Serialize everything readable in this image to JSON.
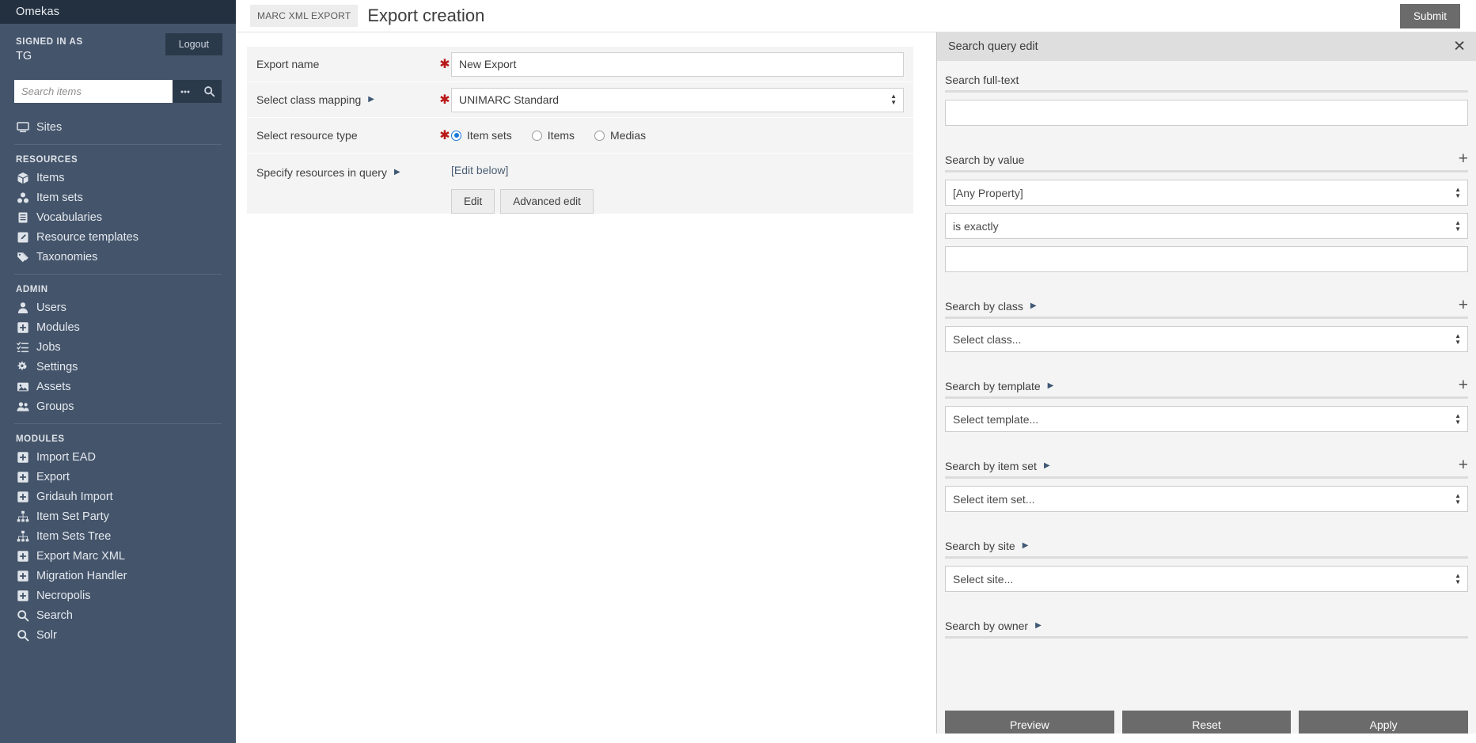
{
  "sidebar": {
    "brand": "Omekas",
    "signed_in_label": "SIGNED IN AS",
    "user": "TG",
    "logout_label": "Logout",
    "search_placeholder": "Search items",
    "search_value": "",
    "advanced_icon": "ellipsis-icon",
    "search_icon": "search-icon",
    "top_items": [
      {
        "label": "Sites",
        "icon": "monitor-icon"
      }
    ],
    "groups": [
      {
        "heading": "RESOURCES",
        "items": [
          {
            "label": "Items",
            "icon": "cube-icon"
          },
          {
            "label": "Item sets",
            "icon": "item-sets-icon"
          },
          {
            "label": "Vocabularies",
            "icon": "book-icon"
          },
          {
            "label": "Resource templates",
            "icon": "pencil-square-icon"
          },
          {
            "label": "Taxonomies",
            "icon": "tags-icon"
          }
        ]
      },
      {
        "heading": "ADMIN",
        "items": [
          {
            "label": "Users",
            "icon": "user-icon"
          },
          {
            "label": "Modules",
            "icon": "plus-square-icon"
          },
          {
            "label": "Jobs",
            "icon": "tasks-icon"
          },
          {
            "label": "Settings",
            "icon": "gears-icon"
          },
          {
            "label": "Assets",
            "icon": "image-icon"
          },
          {
            "label": "Groups",
            "icon": "users-icon"
          }
        ]
      },
      {
        "heading": "MODULES",
        "items": [
          {
            "label": "Import EAD",
            "icon": "plus-square-icon"
          },
          {
            "label": "Export",
            "icon": "plus-square-icon"
          },
          {
            "label": "Gridauh Import",
            "icon": "plus-square-icon"
          },
          {
            "label": "Item Set Party",
            "icon": "sitemap-icon"
          },
          {
            "label": "Item Sets Tree",
            "icon": "sitemap-icon"
          },
          {
            "label": "Export Marc XML",
            "icon": "plus-square-icon"
          },
          {
            "label": "Migration Handler",
            "icon": "plus-square-icon"
          },
          {
            "label": "Necropolis",
            "icon": "plus-square-icon"
          },
          {
            "label": "Search",
            "icon": "search-icon"
          },
          {
            "label": "Solr",
            "icon": "search-icon"
          }
        ]
      }
    ]
  },
  "header": {
    "breadcrumb": "MARC XML EXPORT",
    "title": "Export creation",
    "submit_label": "Submit"
  },
  "form": {
    "export_name": {
      "label": "Export name",
      "required_mark": "✱",
      "value": "New Export"
    },
    "class_mapping": {
      "label": "Select class mapping",
      "required_mark": "✱",
      "value": "UNIMARC Standard"
    },
    "resource_type": {
      "label": "Select resource type",
      "required_mark": "✱",
      "options": [
        {
          "label": "Item sets",
          "selected": true
        },
        {
          "label": "Items",
          "selected": false
        },
        {
          "label": "Medias",
          "selected": false
        }
      ]
    },
    "resources_query": {
      "label": "Specify resources in query",
      "value": "[Edit below]",
      "edit_label": "Edit",
      "advanced_edit_label": "Advanced edit"
    }
  },
  "query_panel": {
    "title": "Search query edit",
    "close_icon": "close-icon",
    "sections": [
      {
        "title": "Search full-text",
        "has_caret": false,
        "has_plus": false,
        "control": "input",
        "value": ""
      },
      {
        "title": "Search by value",
        "has_caret": false,
        "has_plus": true,
        "control": "value-group",
        "property_value": "[Any Property]",
        "operator_value": "is exactly",
        "text_value": ""
      },
      {
        "title": "Search by class",
        "has_caret": true,
        "has_plus": true,
        "control": "select",
        "value": "Select class..."
      },
      {
        "title": "Search by template",
        "has_caret": true,
        "has_plus": true,
        "control": "select",
        "value": "Select template..."
      },
      {
        "title": "Search by item set",
        "has_caret": true,
        "has_plus": true,
        "control": "select",
        "value": "Select item set..."
      },
      {
        "title": "Search by site",
        "has_caret": true,
        "has_plus": false,
        "control": "select",
        "value": "Select site..."
      },
      {
        "title": "Search by owner",
        "has_caret": true,
        "has_plus": false,
        "control": "none"
      }
    ],
    "footer": {
      "preview_label": "Preview",
      "reset_label": "Reset",
      "apply_label": "Apply"
    }
  }
}
